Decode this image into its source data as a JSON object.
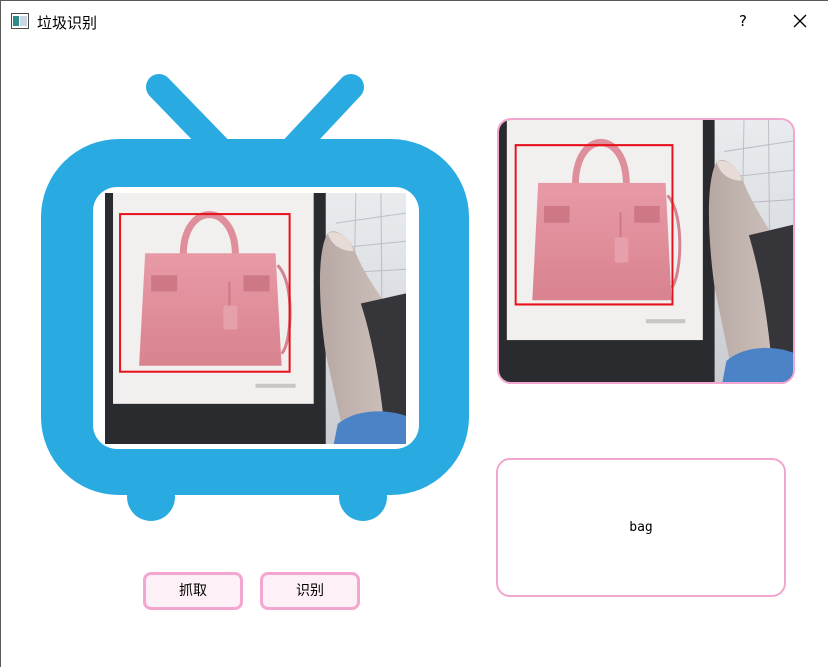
{
  "window": {
    "title": "垃圾识别",
    "help_label": "?",
    "close_icon": "close-icon"
  },
  "camera_view": {
    "detection_color": "#e8101a",
    "frame_color": "#29abe2"
  },
  "capture_view": {
    "detection_color": "#e8101a"
  },
  "result": {
    "label": "bag"
  },
  "buttons": {
    "grab_label": "抓取",
    "identify_label": "识别"
  },
  "colors": {
    "tv_blue": "#29abe2",
    "pink_border": "#f3a6cf",
    "button_fill": "#fdf0f6"
  }
}
